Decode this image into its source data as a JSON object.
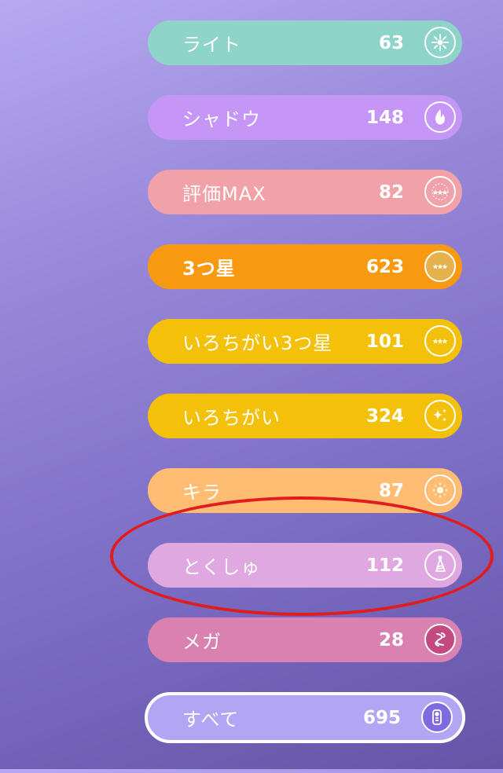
{
  "filters": [
    {
      "key": "light",
      "label": "ライト",
      "count": "63",
      "color": "#8fd4c8",
      "icon": "sparkle-burst-icon"
    },
    {
      "key": "shadow",
      "label": "シャドウ",
      "count": "148",
      "color": "#c596f6",
      "icon": "shadow-flame-icon"
    },
    {
      "key": "max",
      "label": "評価MAX",
      "count": "82",
      "color": "#f0a2a8",
      "icon": "three-stars-ring-icon"
    },
    {
      "key": "three-star",
      "label": "3つ星",
      "count": "623",
      "color": "#f79a12",
      "icon": "three-stars-icon"
    },
    {
      "key": "shiny-three-star",
      "label": "いろちがい3つ星",
      "count": "101",
      "color": "#f4c10a",
      "icon": "three-stars-icon"
    },
    {
      "key": "shiny",
      "label": "いろちがい",
      "count": "324",
      "color": "#f4c10a",
      "icon": "shiny-sparkles-icon"
    },
    {
      "key": "lucky",
      "label": "キラ",
      "count": "87",
      "color": "#ffbd73",
      "icon": "lucky-sparkle-icon"
    },
    {
      "key": "special",
      "label": "とくしゅ",
      "count": "112",
      "color": "#e0a8e0",
      "icon": "party-hat-icon"
    },
    {
      "key": "mega",
      "label": "メガ",
      "count": "28",
      "color": "#d982b2",
      "icon": "mega-evolution-icon"
    },
    {
      "key": "all",
      "label": "すべて",
      "count": "695",
      "color": "#b2a6f4",
      "icon": "pokedex-icon"
    }
  ],
  "selected_filter": "すべて",
  "annotation": {
    "color": "#e01c1c",
    "target": "とくしゅ"
  }
}
